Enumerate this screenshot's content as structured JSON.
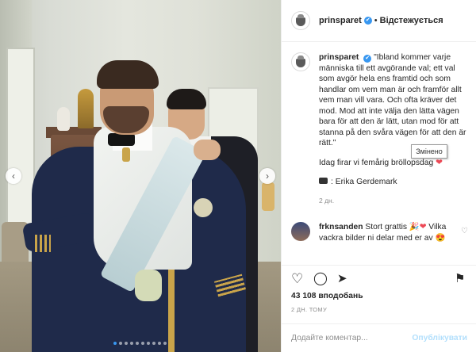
{
  "post": {
    "username": "prinsparet",
    "verified_badge": "✔",
    "separator": "•",
    "follow_label": "Відстежується"
  },
  "caption": {
    "username": "prinsparet",
    "quote": "\"Ibland kommer varje människa till ett avgörande val; ett val som avgör hela ens framtid och som handlar om vem man är och framför allt vem man vill vara. Och ofta kräver det mod. Mod att inte välja den lätta vägen bara för att den är lätt, utan mod för att stanna på den svåra vägen för att den är rätt.\"",
    "line2": "Idag firar vi femårig bröllopsdag",
    "line2_emoji": "❤",
    "credit": "Erika Gerdemark",
    "credit_icon": "camera-icon",
    "credit_prefix": ":",
    "age": "2 дн."
  },
  "tooltip": {
    "text": "Змінено"
  },
  "comment": {
    "username": "frknsanden",
    "text": "Stort grattis",
    "emoji1": "🎉",
    "emoji2": "❤",
    "text2": "Vilka vackra bilder ni delar med er av",
    "emoji3": "😍",
    "like_icon": "♡"
  },
  "actions": {
    "like_icon": "♡",
    "comment_icon": "◯",
    "share_icon": "➤",
    "save_icon": "⚑"
  },
  "likes": "43 108 вподобань",
  "timestamp": "2 ДН. ТОМУ",
  "add_comment": {
    "placeholder": "Додайте коментар...",
    "publish_label": "Опублікувати"
  },
  "carousel": {
    "prev_icon": "‹",
    "next_icon": "›",
    "slides_count": 10,
    "active_slide": 1
  },
  "colors": {
    "accent": "#3897f0",
    "publish_disabled": "#b2dffc",
    "heart": "#ed4956"
  }
}
